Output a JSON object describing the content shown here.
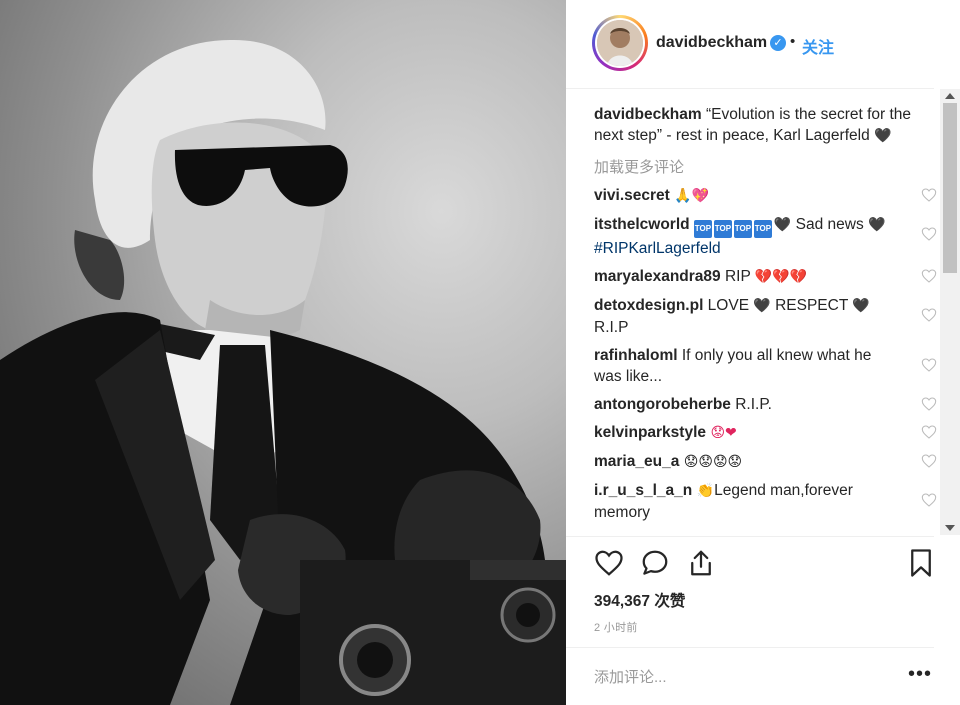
{
  "post": {
    "username": "davidbeckham",
    "follow_label": "关注",
    "dot": "•"
  },
  "caption": {
    "username": "davidbeckham",
    "text": "“Evolution is the secret for the next step” - rest in peace, Karl Lagerfeld",
    "emoji": "🖤"
  },
  "load_more": "加载更多评论",
  "comments": [
    {
      "user": "vivi.secret",
      "text": "",
      "emoji": "🙏💖"
    },
    {
      "user": "itsthelcworld",
      "badges": [
        "TOP",
        "TOP",
        "TOP",
        "TOP"
      ],
      "text_a": " Sad news ",
      "emoji_a": "🖤",
      "emoji_b": "🖤",
      "hashtag": "#RIPKarlLagerfeld"
    },
    {
      "user": "maryalexandra89",
      "text": " RIP ",
      "emoji": "💔💔💔"
    },
    {
      "user": "detoxdesign.pl",
      "text_a": " LOVE ",
      "emoji_a": "🖤",
      "text_b": " RESPECT ",
      "emoji_b": "🖤",
      "text_c": "R.I.P"
    },
    {
      "user": "rafinhaloml",
      "text": " If only you all knew what he was like..."
    },
    {
      "user": "antongorobeherbe",
      "text": " R.I.P."
    },
    {
      "user": "kelvinparkstyle",
      "emoji": " 😟❤"
    },
    {
      "user": "maria_eu_a",
      "emoji": " 😟😟😟😟"
    },
    {
      "user": "i.r_u_s_l_a_n",
      "emoji": " 👏",
      "text": "Legend man,forever memory"
    }
  ],
  "likes": "394,367 次赞",
  "time": "2 小时前",
  "add_comment_placeholder": "添加评论...",
  "more_label": "•••",
  "icons": {
    "verified": "verified-badge-icon",
    "heart": "heart-icon",
    "comment": "comment-icon",
    "share": "share-icon",
    "bookmark": "bookmark-icon"
  },
  "colors": {
    "link_blue": "#3897f0",
    "hashtag_blue": "#003569",
    "muted": "#999999"
  }
}
